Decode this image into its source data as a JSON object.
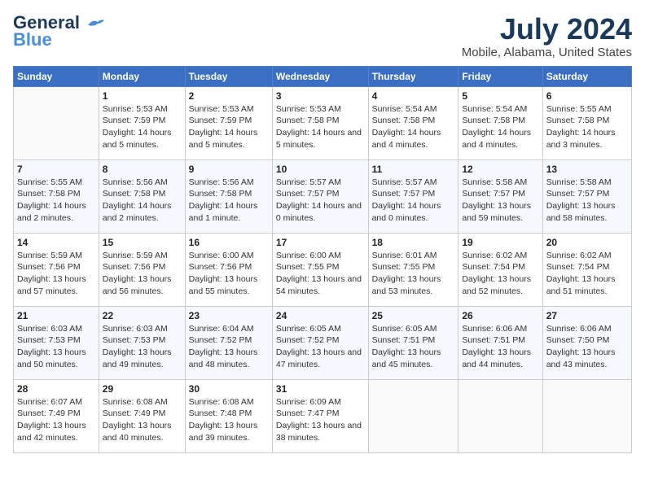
{
  "header": {
    "logo_line1": "General",
    "logo_line2": "Blue",
    "month_year": "July 2024",
    "location": "Mobile, Alabama, United States"
  },
  "weekdays": [
    "Sunday",
    "Monday",
    "Tuesday",
    "Wednesday",
    "Thursday",
    "Friday",
    "Saturday"
  ],
  "weeks": [
    [
      {
        "day": "",
        "sunrise": "",
        "sunset": "",
        "daylight": ""
      },
      {
        "day": "1",
        "sunrise": "Sunrise: 5:53 AM",
        "sunset": "Sunset: 7:59 PM",
        "daylight": "Daylight: 14 hours and 5 minutes."
      },
      {
        "day": "2",
        "sunrise": "Sunrise: 5:53 AM",
        "sunset": "Sunset: 7:59 PM",
        "daylight": "Daylight: 14 hours and 5 minutes."
      },
      {
        "day": "3",
        "sunrise": "Sunrise: 5:53 AM",
        "sunset": "Sunset: 7:58 PM",
        "daylight": "Daylight: 14 hours and 5 minutes."
      },
      {
        "day": "4",
        "sunrise": "Sunrise: 5:54 AM",
        "sunset": "Sunset: 7:58 PM",
        "daylight": "Daylight: 14 hours and 4 minutes."
      },
      {
        "day": "5",
        "sunrise": "Sunrise: 5:54 AM",
        "sunset": "Sunset: 7:58 PM",
        "daylight": "Daylight: 14 hours and 4 minutes."
      },
      {
        "day": "6",
        "sunrise": "Sunrise: 5:55 AM",
        "sunset": "Sunset: 7:58 PM",
        "daylight": "Daylight: 14 hours and 3 minutes."
      }
    ],
    [
      {
        "day": "7",
        "sunrise": "Sunrise: 5:55 AM",
        "sunset": "Sunset: 7:58 PM",
        "daylight": "Daylight: 14 hours and 2 minutes."
      },
      {
        "day": "8",
        "sunrise": "Sunrise: 5:56 AM",
        "sunset": "Sunset: 7:58 PM",
        "daylight": "Daylight: 14 hours and 2 minutes."
      },
      {
        "day": "9",
        "sunrise": "Sunrise: 5:56 AM",
        "sunset": "Sunset: 7:58 PM",
        "daylight": "Daylight: 14 hours and 1 minute."
      },
      {
        "day": "10",
        "sunrise": "Sunrise: 5:57 AM",
        "sunset": "Sunset: 7:57 PM",
        "daylight": "Daylight: 14 hours and 0 minutes."
      },
      {
        "day": "11",
        "sunrise": "Sunrise: 5:57 AM",
        "sunset": "Sunset: 7:57 PM",
        "daylight": "Daylight: 14 hours and 0 minutes."
      },
      {
        "day": "12",
        "sunrise": "Sunrise: 5:58 AM",
        "sunset": "Sunset: 7:57 PM",
        "daylight": "Daylight: 13 hours and 59 minutes."
      },
      {
        "day": "13",
        "sunrise": "Sunrise: 5:58 AM",
        "sunset": "Sunset: 7:57 PM",
        "daylight": "Daylight: 13 hours and 58 minutes."
      }
    ],
    [
      {
        "day": "14",
        "sunrise": "Sunrise: 5:59 AM",
        "sunset": "Sunset: 7:56 PM",
        "daylight": "Daylight: 13 hours and 57 minutes."
      },
      {
        "day": "15",
        "sunrise": "Sunrise: 5:59 AM",
        "sunset": "Sunset: 7:56 PM",
        "daylight": "Daylight: 13 hours and 56 minutes."
      },
      {
        "day": "16",
        "sunrise": "Sunrise: 6:00 AM",
        "sunset": "Sunset: 7:56 PM",
        "daylight": "Daylight: 13 hours and 55 minutes."
      },
      {
        "day": "17",
        "sunrise": "Sunrise: 6:00 AM",
        "sunset": "Sunset: 7:55 PM",
        "daylight": "Daylight: 13 hours and 54 minutes."
      },
      {
        "day": "18",
        "sunrise": "Sunrise: 6:01 AM",
        "sunset": "Sunset: 7:55 PM",
        "daylight": "Daylight: 13 hours and 53 minutes."
      },
      {
        "day": "19",
        "sunrise": "Sunrise: 6:02 AM",
        "sunset": "Sunset: 7:54 PM",
        "daylight": "Daylight: 13 hours and 52 minutes."
      },
      {
        "day": "20",
        "sunrise": "Sunrise: 6:02 AM",
        "sunset": "Sunset: 7:54 PM",
        "daylight": "Daylight: 13 hours and 51 minutes."
      }
    ],
    [
      {
        "day": "21",
        "sunrise": "Sunrise: 6:03 AM",
        "sunset": "Sunset: 7:53 PM",
        "daylight": "Daylight: 13 hours and 50 minutes."
      },
      {
        "day": "22",
        "sunrise": "Sunrise: 6:03 AM",
        "sunset": "Sunset: 7:53 PM",
        "daylight": "Daylight: 13 hours and 49 minutes."
      },
      {
        "day": "23",
        "sunrise": "Sunrise: 6:04 AM",
        "sunset": "Sunset: 7:52 PM",
        "daylight": "Daylight: 13 hours and 48 minutes."
      },
      {
        "day": "24",
        "sunrise": "Sunrise: 6:05 AM",
        "sunset": "Sunset: 7:52 PM",
        "daylight": "Daylight: 13 hours and 47 minutes."
      },
      {
        "day": "25",
        "sunrise": "Sunrise: 6:05 AM",
        "sunset": "Sunset: 7:51 PM",
        "daylight": "Daylight: 13 hours and 45 minutes."
      },
      {
        "day": "26",
        "sunrise": "Sunrise: 6:06 AM",
        "sunset": "Sunset: 7:51 PM",
        "daylight": "Daylight: 13 hours and 44 minutes."
      },
      {
        "day": "27",
        "sunrise": "Sunrise: 6:06 AM",
        "sunset": "Sunset: 7:50 PM",
        "daylight": "Daylight: 13 hours and 43 minutes."
      }
    ],
    [
      {
        "day": "28",
        "sunrise": "Sunrise: 6:07 AM",
        "sunset": "Sunset: 7:49 PM",
        "daylight": "Daylight: 13 hours and 42 minutes."
      },
      {
        "day": "29",
        "sunrise": "Sunrise: 6:08 AM",
        "sunset": "Sunset: 7:49 PM",
        "daylight": "Daylight: 13 hours and 40 minutes."
      },
      {
        "day": "30",
        "sunrise": "Sunrise: 6:08 AM",
        "sunset": "Sunset: 7:48 PM",
        "daylight": "Daylight: 13 hours and 39 minutes."
      },
      {
        "day": "31",
        "sunrise": "Sunrise: 6:09 AM",
        "sunset": "Sunset: 7:47 PM",
        "daylight": "Daylight: 13 hours and 38 minutes."
      },
      {
        "day": "",
        "sunrise": "",
        "sunset": "",
        "daylight": ""
      },
      {
        "day": "",
        "sunrise": "",
        "sunset": "",
        "daylight": ""
      },
      {
        "day": "",
        "sunrise": "",
        "sunset": "",
        "daylight": ""
      }
    ]
  ]
}
